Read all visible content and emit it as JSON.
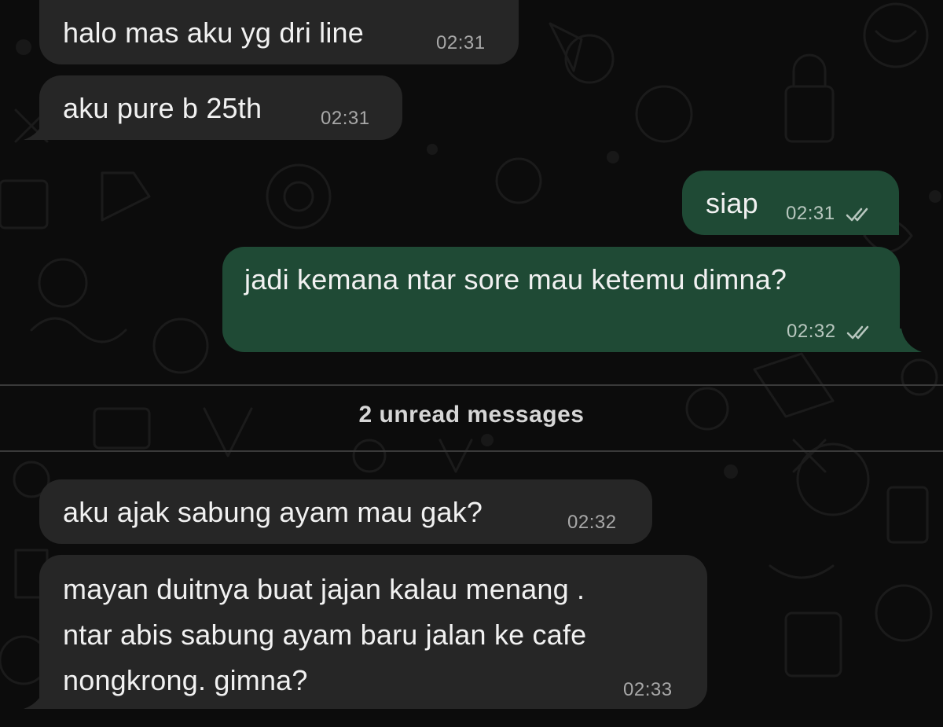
{
  "messages": [
    {
      "direction": "incoming",
      "text": "halo mas aku yg dri line",
      "time": "02:31"
    },
    {
      "direction": "incoming",
      "text": "aku pure b 25th",
      "time": "02:31"
    },
    {
      "direction": "outgoing",
      "text": "siap",
      "time": "02:31",
      "status": "read"
    },
    {
      "direction": "outgoing",
      "text": "jadi kemana ntar sore mau ketemu dimna?",
      "time": "02:32",
      "status": "read"
    },
    {
      "direction": "incoming",
      "text": "aku ajak sabung ayam mau gak?",
      "time": "02:32"
    },
    {
      "direction": "incoming",
      "text_lines": [
        "mayan duitnya buat jajan kalau menang .",
        "ntar abis sabung ayam baru jalan ke cafe",
        "nongkrong. gimna?"
      ],
      "time": "02:33"
    }
  ],
  "divider": {
    "label": "2 unread messages"
  },
  "icons": {
    "read_receipt": "double-check-icon"
  },
  "colors": {
    "background": "#0c0c0c",
    "incoming_bubble": "#262626",
    "outgoing_bubble": "#1f4a35"
  }
}
